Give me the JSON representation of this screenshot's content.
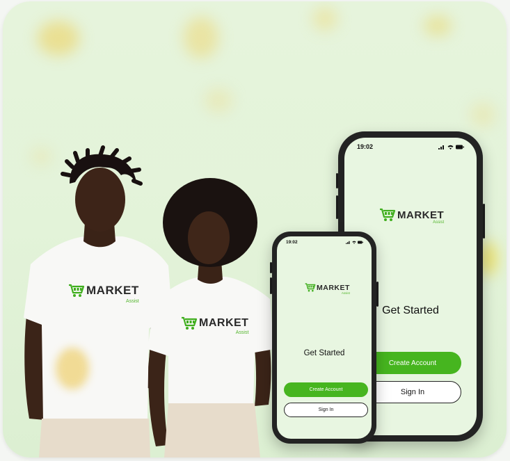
{
  "brand": {
    "name": "MARKET",
    "tagline": "Assist",
    "accent_color": "#46b51f"
  },
  "shirts": [
    {
      "logo_word": "MARKET",
      "logo_sub": "Assist"
    },
    {
      "logo_word": "MARKET",
      "logo_sub": "Assist"
    }
  ],
  "large_phone": {
    "time": "19:02",
    "status_icons": [
      "signal-icon",
      "wifi-icon",
      "battery-icon"
    ],
    "logo_word": "MARKET",
    "logo_sub": "Assist",
    "title": "Get Started",
    "create_account_label": "Create Account",
    "sign_in_label": "Sign In"
  },
  "small_phone": {
    "time": "19:02",
    "status_icons": [
      "signal-icon",
      "wifi-icon",
      "battery-icon"
    ],
    "logo_word": "MARKET",
    "logo_sub": "Assist",
    "title": "Get Started",
    "create_account_label": "Create Account",
    "sign_in_label": "Sign In"
  }
}
